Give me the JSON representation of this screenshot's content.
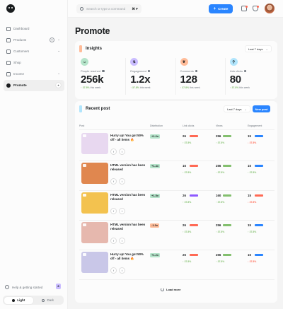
{
  "sidebar": {
    "items": [
      {
        "label": "Dashboard",
        "icon": "home-icon"
      },
      {
        "label": "Products",
        "icon": "diamond-icon"
      },
      {
        "label": "Customers",
        "icon": "users-icon"
      },
      {
        "label": "Shop",
        "icon": "store-icon"
      },
      {
        "label": "Income",
        "icon": "coin-icon"
      },
      {
        "label": "Promote",
        "icon": "promote-icon"
      }
    ],
    "help_label": "Help & getting started",
    "help_count": "8",
    "theme_light": "Light",
    "theme_dark": "Dark"
  },
  "topbar": {
    "search_placeholder": "Search or type a command",
    "search_shortcut": "⌘ F",
    "create_label": "Create"
  },
  "page_title": "Promote",
  "insights": {
    "title": "Insights",
    "range": "Last 7 days",
    "metrics": [
      {
        "label": "People reached",
        "value": "256k",
        "change": "37.8%",
        "suffix": "this week",
        "direction": "up",
        "color": "#b5e4ca",
        "icon": "users-icon"
      },
      {
        "label": "Engagement",
        "value": "1.2x",
        "change": "37.8%",
        "suffix": "this week",
        "direction": "up",
        "color": "#cabdff",
        "icon": "swap-icon"
      },
      {
        "label": "Comments",
        "value": "128",
        "change": "37.8%",
        "suffix": "this week",
        "direction": "up",
        "color": "#ffbc99",
        "icon": "leaf-icon"
      },
      {
        "label": "Link clicks",
        "value": "80",
        "change": "37.8%",
        "suffix": "this week",
        "direction": "up",
        "color": "#b1e5fc",
        "icon": "link-icon"
      }
    ]
  },
  "recent": {
    "title": "Recent post",
    "range": "Last 7 days",
    "new_post_label": "New post",
    "columns": {
      "post": "Post",
      "distribution": "Distribution",
      "link_clicks": "Link clicks",
      "views": "Views",
      "engagement": "Engagement"
    },
    "rows": [
      {
        "title": "Hurry up! You got 50% off - all items 🔥",
        "distribution": "+1.2x",
        "dist_color": "#b5e4ca",
        "clicks": "26",
        "clicks_color": "#ff6a55",
        "clicks_change": "37.8%",
        "clicks_dir": "up",
        "views": "256",
        "views_color": "#83bf6e",
        "views_change": "37.8%",
        "views_dir": "up",
        "eng": "15",
        "eng_color": "#2a85ff",
        "eng_change": "37.8%",
        "eng_dir": "down",
        "thumb": "#e8d8f0"
      },
      {
        "title": "HTML version has been released",
        "distribution": "+1.4x",
        "dist_color": "#b5e4ca",
        "clicks": "16",
        "clicks_color": "#ff6a55",
        "clicks_change": "37.8%",
        "clicks_dir": "up",
        "views": "256",
        "views_color": "#83bf6e",
        "views_change": "37.8%",
        "views_dir": "up",
        "eng": "15",
        "eng_color": "#2a85ff",
        "eng_change": "37.8%",
        "eng_dir": "up",
        "thumb": "#e0874f"
      },
      {
        "title": "HTML version has been released",
        "distribution": "+1.5x",
        "dist_color": "#b5e4ca",
        "clicks": "26",
        "clicks_color": "#8e59ff",
        "clicks_change": "37.8%",
        "clicks_dir": "up",
        "views": "160",
        "views_color": "#83bf6e",
        "views_change": "37.8%",
        "views_dir": "up",
        "eng": "15",
        "eng_color": "#ff6a55",
        "eng_change": "37.8%",
        "eng_dir": "down",
        "thumb": "#f3c24f"
      },
      {
        "title": "HTML version has been released",
        "distribution": "-1.3x",
        "dist_color": "#ffbc99",
        "clicks": "26",
        "clicks_color": "#ff6a55",
        "clicks_change": "37.8%",
        "clicks_dir": "up",
        "views": "256",
        "views_color": "#83bf6e",
        "views_change": "37.8%",
        "views_dir": "up",
        "eng": "15",
        "eng_color": "#2a85ff",
        "eng_change": "37.8%",
        "eng_dir": "up",
        "thumb": "#e6b8ae"
      },
      {
        "title": "Hurry up! You got 50% off - all items 🔥",
        "distribution": "+1.2x",
        "dist_color": "#b5e4ca",
        "clicks": "26",
        "clicks_color": "#ff6a55",
        "clicks_change": "37.8%",
        "clicks_dir": "up",
        "views": "256",
        "views_color": "#83bf6e",
        "views_change": "37.8%",
        "views_dir": "up",
        "eng": "15",
        "eng_color": "#2a85ff",
        "eng_change": "37.8%",
        "eng_dir": "down",
        "thumb": "#c9c7e8"
      }
    ],
    "load_more": "Load more"
  }
}
